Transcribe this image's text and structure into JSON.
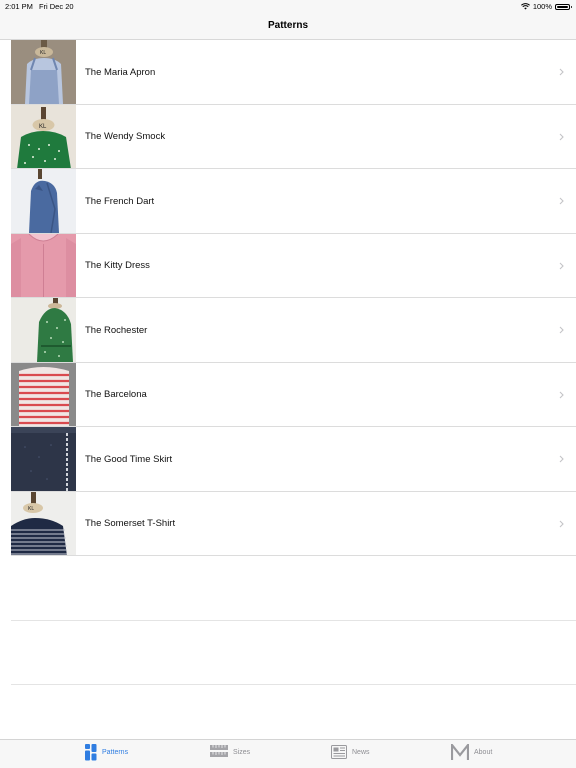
{
  "status_bar": {
    "time": "2:01 PM",
    "date": "Fri Dec 20",
    "battery": "100%",
    "battery_level": 1.0
  },
  "nav": {
    "title": "Patterns"
  },
  "patterns": [
    {
      "name": "The Maria Apron",
      "image": "blue-apron-on-dress-form"
    },
    {
      "name": "The Wendy Smock",
      "image": "green-polka-dot-smock-on-dress-form"
    },
    {
      "name": "The French Dart",
      "image": "blue-fitted-dress-on-dress-form"
    },
    {
      "name": "The Kitty Dress",
      "image": "pink-dress-with-peter-pan-collar"
    },
    {
      "name": "The Rochester",
      "image": "green-patterned-wrap-top"
    },
    {
      "name": "The Barcelona",
      "image": "red-white-striped-dress"
    },
    {
      "name": "The Good Time Skirt",
      "image": "navy-denim-skirt"
    },
    {
      "name": "The Somerset T-Shirt",
      "image": "navy-striped-t-shirt-on-dress-form"
    }
  ],
  "tabs": [
    {
      "label": "Patterns",
      "icon": "grid-icon",
      "active": true
    },
    {
      "label": "Sizes",
      "icon": "tape-measure-icon",
      "active": false
    },
    {
      "label": "News",
      "icon": "newspaper-icon",
      "active": false
    },
    {
      "label": "About",
      "icon": "m-logo-icon",
      "active": false
    }
  ],
  "colors": {
    "accent": "#2f7de1",
    "inactive": "#8e8e93",
    "separator": "#dcdcdc",
    "bar_background": "#f7f7f7"
  }
}
